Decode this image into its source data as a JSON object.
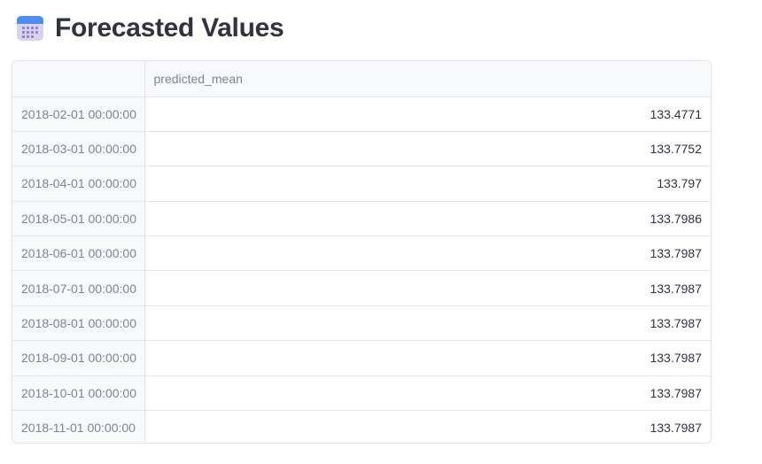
{
  "header": {
    "title": "Forecasted Values",
    "icon": "calendar-icon"
  },
  "table": {
    "index_header": "",
    "columns": [
      "predicted_mean"
    ],
    "rows": [
      {
        "index": "2018-02-01 00:00:00",
        "predicted_mean": "133.4771"
      },
      {
        "index": "2018-03-01 00:00:00",
        "predicted_mean": "133.7752"
      },
      {
        "index": "2018-04-01 00:00:00",
        "predicted_mean": "133.797"
      },
      {
        "index": "2018-05-01 00:00:00",
        "predicted_mean": "133.7986"
      },
      {
        "index": "2018-06-01 00:00:00",
        "predicted_mean": "133.7987"
      },
      {
        "index": "2018-07-01 00:00:00",
        "predicted_mean": "133.7987"
      },
      {
        "index": "2018-08-01 00:00:00",
        "predicted_mean": "133.7987"
      },
      {
        "index": "2018-09-01 00:00:00",
        "predicted_mean": "133.7987"
      },
      {
        "index": "2018-10-01 00:00:00",
        "predicted_mean": "133.7987"
      },
      {
        "index": "2018-11-01 00:00:00",
        "predicted_mean": "133.7987"
      }
    ]
  },
  "colors": {
    "title": "#31333f",
    "muted_text": "#808495",
    "border": "#e6e6ea",
    "header_bg": "#f8f9fb"
  }
}
